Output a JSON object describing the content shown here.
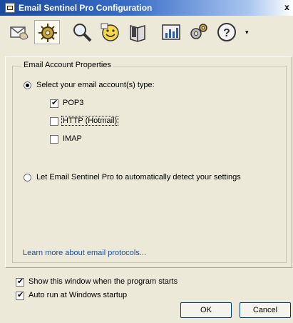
{
  "window": {
    "title": "Email Sentinel Pro Configuration",
    "close_glyph": "x"
  },
  "toolbar": {
    "buttons": [
      {
        "icon": "email-hand-icon"
      },
      {
        "icon": "gear-sparkle-icon",
        "selected": true
      },
      {
        "icon": "magnifier-icon"
      },
      {
        "icon": "smiley-icon"
      },
      {
        "icon": "book-icon"
      },
      {
        "icon": "chart-icon"
      },
      {
        "icon": "settings-gears-icon"
      },
      {
        "icon": "help-icon"
      }
    ],
    "dropdown_glyph": "▾"
  },
  "group": {
    "title": "Email Account Properties",
    "radio_select_label": "Select your email account(s) type:",
    "radio_select_checked": true,
    "types": [
      {
        "label": "POP3",
        "checked": true
      },
      {
        "label": "HTTP (Hotmail)",
        "checked": false,
        "focused": true
      },
      {
        "label": "IMAP",
        "checked": false
      }
    ],
    "radio_auto_label": "Let Email Sentinel Pro to automatically detect your settings",
    "radio_auto_checked": false,
    "learn_more_link": "Learn more about email protocols..."
  },
  "options": {
    "show_window_label": "Show this window when the program starts",
    "show_window_checked": true,
    "auto_run_label": "Auto run at Windows startup",
    "auto_run_checked": true
  },
  "buttons": {
    "ok": "OK",
    "cancel": "Cancel"
  },
  "colors": {
    "title_bar": "#1b4a9c",
    "link": "#1e4e9c",
    "background": "#ece9d8"
  }
}
